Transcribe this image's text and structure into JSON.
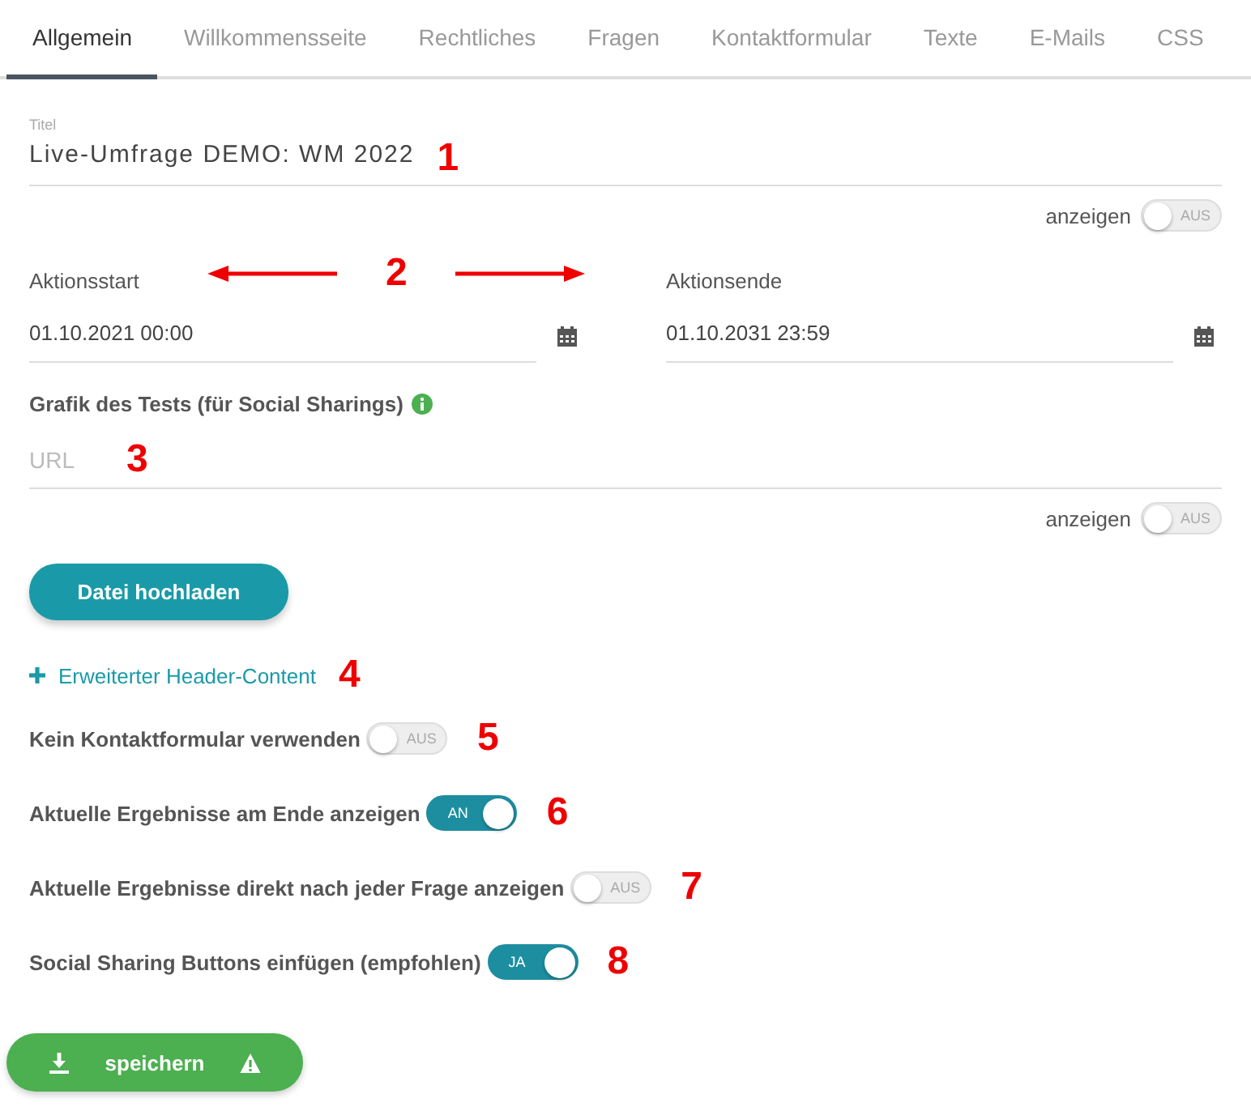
{
  "tabs": [
    {
      "label": "Allgemein",
      "selected": true
    },
    {
      "label": "Willkommensseite",
      "selected": false
    },
    {
      "label": "Rechtliches",
      "selected": false
    },
    {
      "label": "Fragen",
      "selected": false
    },
    {
      "label": "Kontaktformular",
      "selected": false
    },
    {
      "label": "Texte",
      "selected": false
    },
    {
      "label": "E-Mails",
      "selected": false
    },
    {
      "label": "CSS",
      "selected": false
    }
  ],
  "title_field": {
    "label": "Titel",
    "value": "Live-Umfrage DEMO: WM 2022",
    "marker": "1"
  },
  "title_visibility": {
    "label": "anzeigen",
    "toggle": "AUS",
    "on": false
  },
  "dates": {
    "marker": "2",
    "fields": [
      {
        "label": "Aktionsstart",
        "value": "01.10.2021 00:00"
      },
      {
        "label": "Aktionsende",
        "value": "01.10.2031 23:59"
      }
    ]
  },
  "image": {
    "label": "Grafik des Tests (für Social Sharings)",
    "placeholder": "URL",
    "marker": "3"
  },
  "image_visibility": {
    "label": "anzeigen",
    "toggle": "AUS",
    "on": false
  },
  "upload_button": "Datei hochladen",
  "header_link": {
    "label": "Erweiterter Header-Content",
    "marker": "4"
  },
  "options": [
    {
      "label": "Kein Kontaktformular verwenden",
      "toggle": "AUS",
      "on": false,
      "marker": "5"
    },
    {
      "label": "Aktuelle Ergebnisse am Ende anzeigen",
      "toggle": "AN",
      "on": true,
      "marker": "6"
    },
    {
      "label": "Aktuelle Ergebnisse direkt nach jeder Frage anzeigen",
      "toggle": "AUS",
      "on": false,
      "marker": "7"
    },
    {
      "label": "Social Sharing Buttons einfügen (empfohlen)",
      "toggle": "JA",
      "on": true,
      "marker": "8"
    }
  ],
  "save_button": "speichern"
}
